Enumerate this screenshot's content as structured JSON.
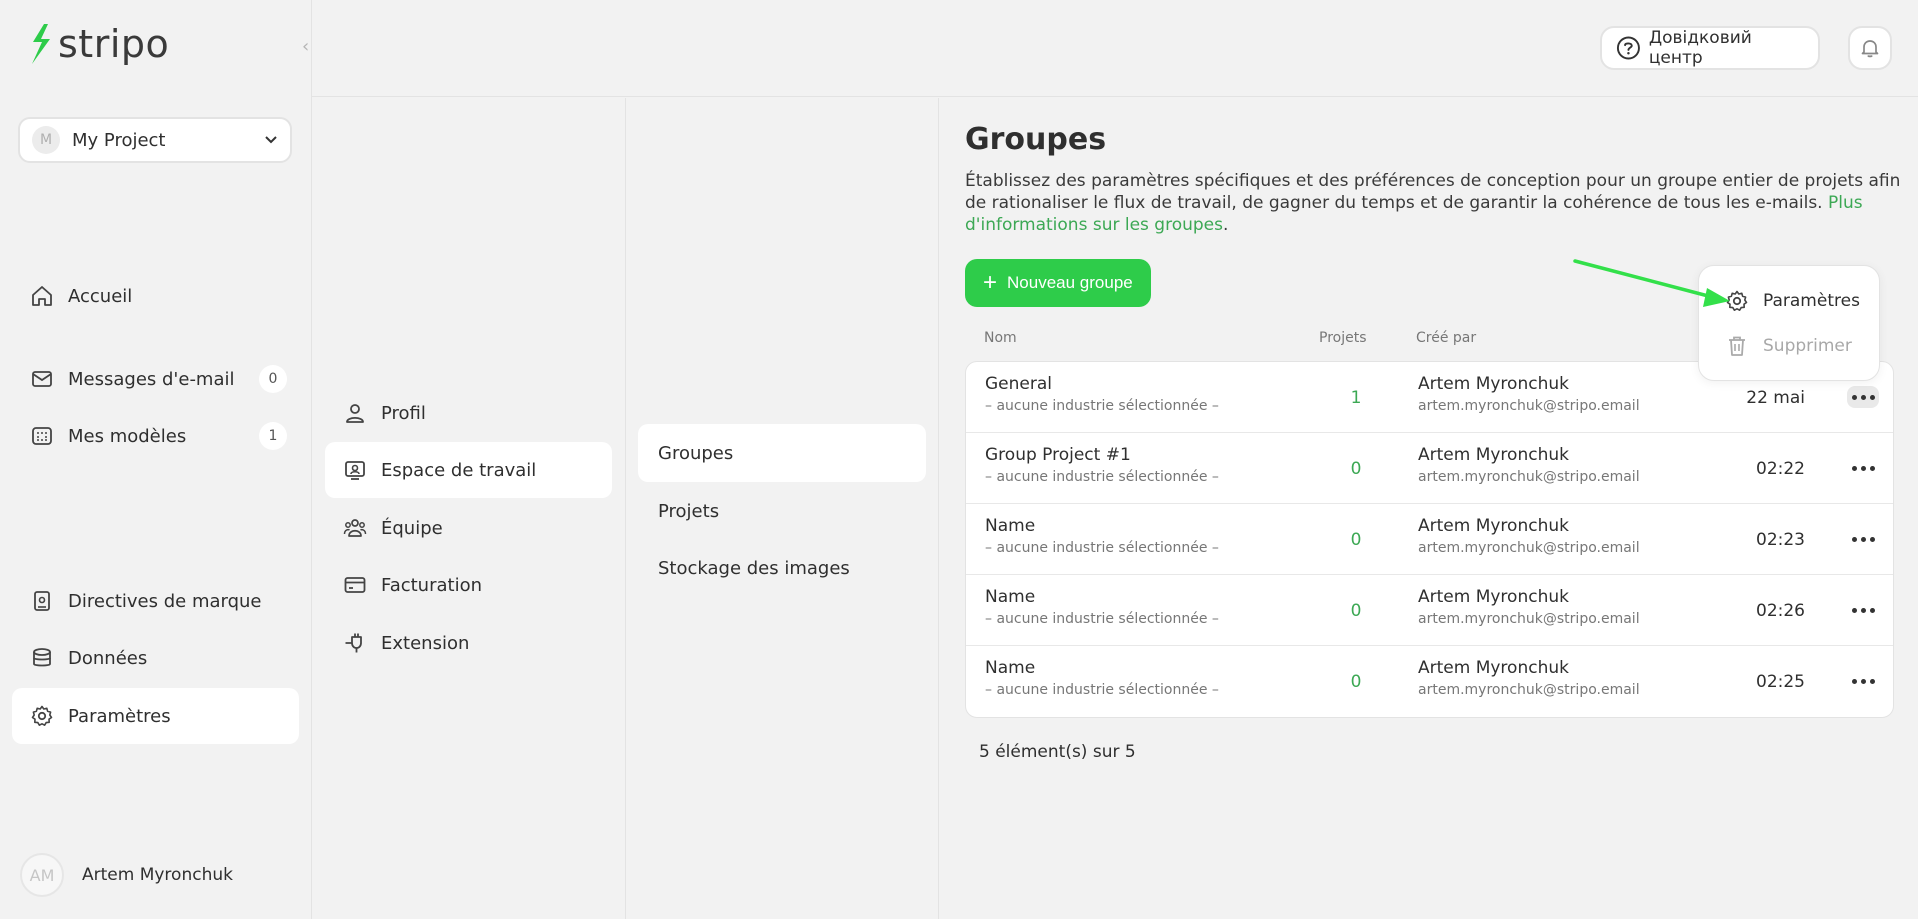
{
  "brand": {
    "name": "stripo",
    "accent": "#2ecc4a",
    "link_color": "#3ca854"
  },
  "project": {
    "avatar": "M",
    "name": "My Project"
  },
  "sidebar": {
    "items": [
      {
        "label": "Accueil",
        "icon": "home-icon"
      },
      {
        "label": "Messages d'e-mail",
        "icon": "envelope-icon",
        "count": "0"
      },
      {
        "label": "Mes modèles",
        "icon": "templates-icon",
        "count": "1"
      },
      {
        "label": "Directives de marque",
        "icon": "brand-book-icon"
      },
      {
        "label": "Données",
        "icon": "database-icon"
      },
      {
        "label": "Paramètres",
        "icon": "gear-icon"
      }
    ]
  },
  "user": {
    "initials": "AM",
    "name": "Artem Myronchuk"
  },
  "header": {
    "help_label": "Довідковий центр"
  },
  "settings_nav": {
    "items": [
      {
        "label": "Profil"
      },
      {
        "label": "Espace de travail"
      },
      {
        "label": "Équipe"
      },
      {
        "label": "Facturation"
      },
      {
        "label": "Extension"
      }
    ]
  },
  "workspace_nav": {
    "items": [
      {
        "label": "Groupes"
      },
      {
        "label": "Projets"
      },
      {
        "label": "Stockage des images"
      }
    ]
  },
  "main": {
    "title": "Groupes",
    "description": "Établissez des paramètres spécifiques et des préférences de conception pour un groupe entier de projets afin de rationaliser le flux de travail, de gagner du temps et de garantir la cohérence de tous les e-mails.",
    "description_link": "Plus d'informations sur les groupes",
    "new_button": "Nouveau groupe",
    "columns": {
      "name": "Nom",
      "projects": "Projets",
      "created_by": "Créé par"
    },
    "rows": [
      {
        "name": "General",
        "industry": "– aucune industrie sélectionnée –",
        "projects": "1",
        "author": "Artem Myronchuk",
        "email": "artem.myronchuk@stripo.email",
        "date": "22 mai"
      },
      {
        "name": "Group Project #1",
        "industry": "– aucune industrie sélectionnée –",
        "projects": "0",
        "author": "Artem Myronchuk",
        "email": "artem.myronchuk@stripo.email",
        "date": "02:22"
      },
      {
        "name": "Name",
        "industry": "– aucune industrie sélectionnée –",
        "projects": "0",
        "author": "Artem Myronchuk",
        "email": "artem.myronchuk@stripo.email",
        "date": "02:23"
      },
      {
        "name": "Name",
        "industry": "– aucune industrie sélectionnée –",
        "projects": "0",
        "author": "Artem Myronchuk",
        "email": "artem.myronchuk@stripo.email",
        "date": "02:26"
      },
      {
        "name": "Name",
        "industry": "– aucune industrie sélectionnée –",
        "projects": "0",
        "author": "Artem Myronchuk",
        "email": "artem.myronchuk@stripo.email",
        "date": "02:25"
      }
    ],
    "footer_count": "5 élément(s) sur 5"
  },
  "context_menu": {
    "items": [
      {
        "label": "Paramètres",
        "icon": "gear-icon"
      },
      {
        "label": "Supprimer",
        "icon": "trash-icon"
      }
    ]
  }
}
